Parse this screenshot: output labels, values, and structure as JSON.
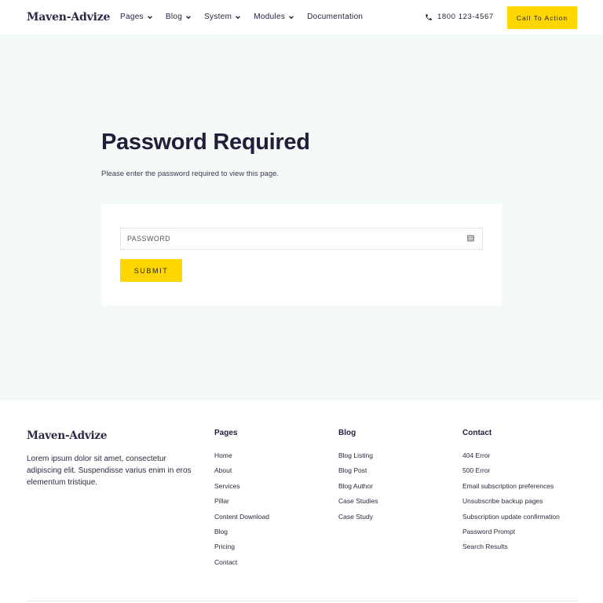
{
  "header": {
    "logo": "Maven-Advize",
    "nav": [
      {
        "label": "Pages",
        "dropdown": true
      },
      {
        "label": "Blog",
        "dropdown": true
      },
      {
        "label": "System",
        "dropdown": true
      },
      {
        "label": "Modules",
        "dropdown": true
      },
      {
        "label": "Documentation",
        "dropdown": false
      }
    ],
    "phone": "1800 123-4567",
    "cta_label": "Call To Action"
  },
  "main": {
    "title": "Password Required",
    "description": "Please enter the password required to view this page.",
    "password_placeholder": "PASSWORD",
    "password_value": "",
    "submit_label": "SUBMIT"
  },
  "footer": {
    "logo": "Maven-Advize",
    "description": "Lorem ipsum dolor sit amet, consectetur adipiscing elit. Suspendisse varius enim in eros elementum tristique.",
    "columns": [
      {
        "title": "Pages",
        "links": [
          "Home",
          "About",
          "Services",
          "Pillar",
          "Content Download",
          "Blog",
          "Pricing",
          "Contact"
        ]
      },
      {
        "title": "Blog",
        "links": [
          "Blog Listing",
          "Blog Post",
          "Blog Author",
          "Case Studies",
          "Case Study"
        ]
      },
      {
        "title": "Contact",
        "links": [
          "404 Error",
          "500 Error",
          "Email subscription preferences",
          "Unsubscribe backup pages",
          "Subscription update confirmation",
          "Password Prompt",
          "Search Results"
        ]
      }
    ]
  },
  "colors": {
    "accent": "#ffd600",
    "hero_bg": "#f3faf8",
    "text": "#1f1f3a"
  },
  "icons": {
    "nav_dropdown": "chevron-down-icon",
    "phone": "phone-icon",
    "password_field": "keyboard-icon"
  }
}
